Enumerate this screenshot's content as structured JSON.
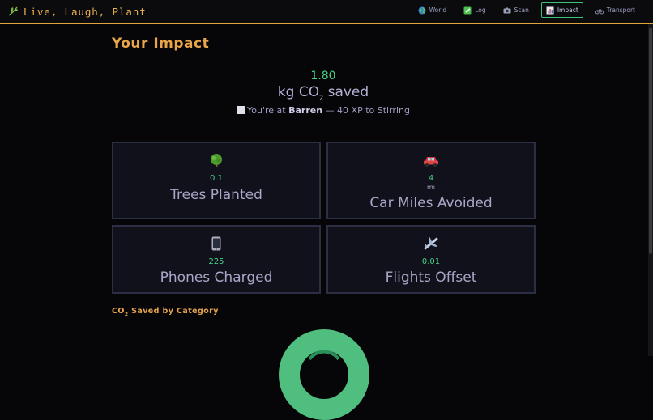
{
  "header": {
    "brand": "Live, Laugh, Plant",
    "nav": [
      {
        "label": "World",
        "icon": "globe-icon"
      },
      {
        "label": "Log",
        "icon": "checkbox-icon"
      },
      {
        "label": "Scan",
        "icon": "camera-icon"
      },
      {
        "label": "Impact",
        "icon": "chart-icon",
        "active": true
      },
      {
        "label": "Transport",
        "icon": "bike-icon"
      }
    ]
  },
  "impact": {
    "title": "Your Impact",
    "co2_value": "1.80",
    "co2_unit_prefix": "kg CO",
    "co2_unit_sub": "2",
    "co2_unit_suffix": " saved",
    "level_prefix": "You're at ",
    "level_name": "Barren",
    "level_suffix": " — 40 XP to Stirring"
  },
  "cards": [
    {
      "icon": "tree-icon",
      "value": "0.1",
      "unit": "",
      "label": "Trees Planted"
    },
    {
      "icon": "car-icon",
      "value": "4",
      "unit": "mi",
      "label": "Car Miles Avoided"
    },
    {
      "icon": "phone-icon",
      "value": "225",
      "unit": "",
      "label": "Phones Charged"
    },
    {
      "icon": "airplane-icon",
      "value": "0.01",
      "unit": "",
      "label": "Flights Offset"
    }
  ],
  "category_section": {
    "title_prefix": "CO",
    "title_sub": "2",
    "title_suffix": " Saved by Category"
  },
  "colors": {
    "accent": "#e9a548",
    "positive": "#43d383",
    "donut": "#4fbe7f"
  }
}
